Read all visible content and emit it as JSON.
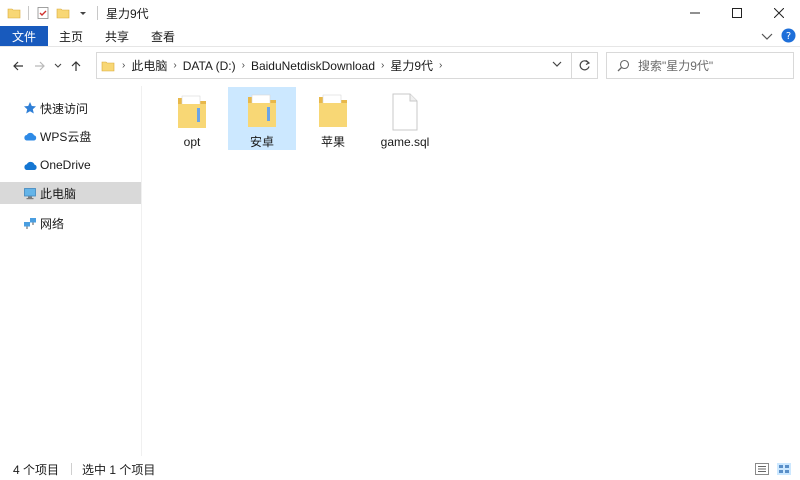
{
  "window": {
    "title": "星力9代"
  },
  "ribbon": {
    "tabs": [
      {
        "label": "文件"
      },
      {
        "label": "主页"
      },
      {
        "label": "共享"
      },
      {
        "label": "查看"
      }
    ]
  },
  "address": {
    "breadcrumbs": [
      "此电脑",
      "DATA (D:)",
      "BaiduNetdiskDownload",
      "星力9代"
    ]
  },
  "search": {
    "placeholder": "搜索\"星力9代\""
  },
  "sidebar": {
    "items": [
      {
        "label": "快速访问",
        "icon": "star-icon"
      },
      {
        "label": "WPS云盘",
        "icon": "wps-cloud-icon"
      },
      {
        "label": "OneDrive",
        "icon": "onedrive-cloud-icon"
      },
      {
        "label": "此电脑",
        "icon": "computer-icon",
        "selected": true
      },
      {
        "label": "网络",
        "icon": "network-icon"
      }
    ]
  },
  "files": [
    {
      "name": "opt",
      "type": "folder",
      "selected": false
    },
    {
      "name": "安卓",
      "type": "folder",
      "selected": true
    },
    {
      "name": "苹果",
      "type": "folder",
      "selected": false
    },
    {
      "name": "game.sql",
      "type": "file",
      "selected": false
    }
  ],
  "status": {
    "item_count": "4 个项目",
    "selected_count": "选中 1 个项目"
  },
  "colors": {
    "file_tab": "#185abd",
    "selection": "#cce8ff",
    "sidebar_selection": "#d9d9d9",
    "folder_yellow": "#f8d775"
  }
}
